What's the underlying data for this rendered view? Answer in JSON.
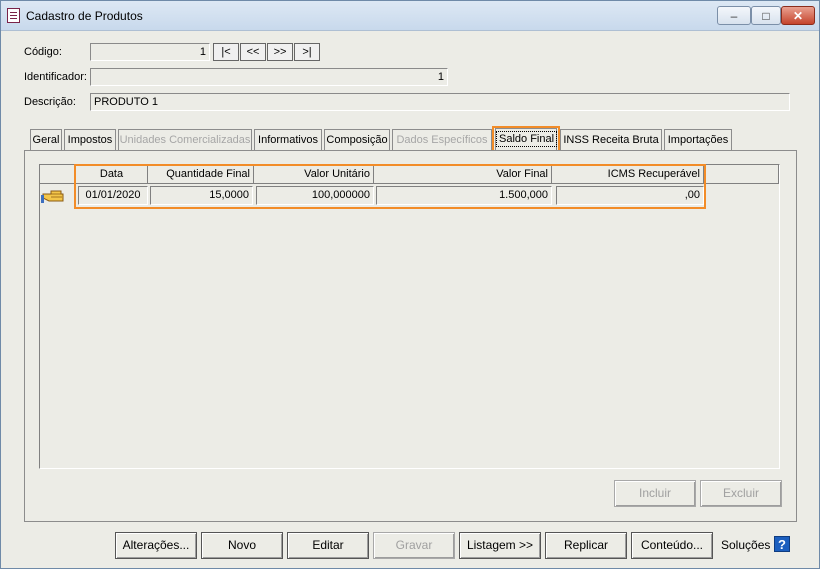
{
  "window": {
    "title": "Cadastro de Produtos",
    "minimize": "–",
    "maximize": "□",
    "close": "✕"
  },
  "form": {
    "codigo_label": "Código:",
    "codigo_value": "1",
    "nav": [
      "|<",
      "<<",
      ">>",
      ">|"
    ],
    "identificador_label": "Identificador:",
    "identificador_value": "1",
    "descricao_label": "Descrição:",
    "descricao_value": "PRODUTO 1"
  },
  "tabs": [
    {
      "label": "Geral",
      "state": "normal"
    },
    {
      "label": "Impostos",
      "state": "normal"
    },
    {
      "label": "Unidades Comercializadas",
      "state": "disabled"
    },
    {
      "label": "Informativos",
      "state": "normal"
    },
    {
      "label": "Composição",
      "state": "normal"
    },
    {
      "label": "Dados Específicos",
      "state": "disabled"
    },
    {
      "label": "Saldo Final",
      "state": "active"
    },
    {
      "label": "INSS Receita Bruta",
      "state": "normal"
    },
    {
      "label": "Importações",
      "state": "normal"
    }
  ],
  "grid": {
    "columns": [
      "Data",
      "Quantidade Final",
      "Valor Unitário",
      "Valor Final",
      "ICMS Recuperável"
    ],
    "rows": [
      [
        "01/01/2020",
        "15,0000",
        "100,000000",
        "1.500,000",
        ",00"
      ]
    ]
  },
  "panel_buttons": {
    "incluir": "Incluir",
    "excluir": "Excluir"
  },
  "bottom_buttons": {
    "alteracoes": "Alterações...",
    "novo": "Novo",
    "editar": "Editar",
    "gravar": "Gravar",
    "listagem": "Listagem >>",
    "replicar": "Replicar",
    "conteudo": "Conteúdo...",
    "solucoes": "Soluções",
    "help": "?"
  },
  "colors": {
    "highlight": "#f28c28",
    "help_blue": "#1c5fbf"
  }
}
